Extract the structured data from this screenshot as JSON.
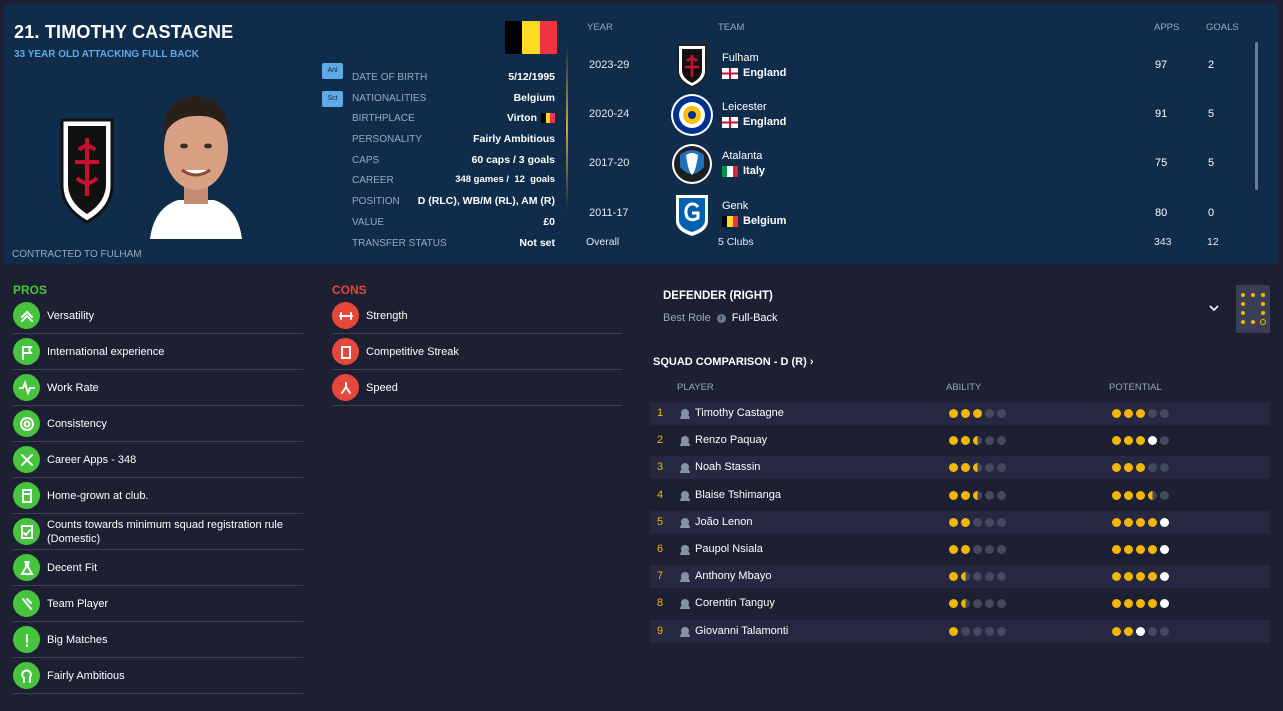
{
  "player": {
    "name": "21. TIMOTHY CASTAGNE",
    "descriptor": "33 YEAR OLD ATTACKING FULL BACK",
    "contract": "CONTRACTED TO FULHAM",
    "tag1": "Anl",
    "tag2": "Sct"
  },
  "info": [
    {
      "label": "DATE OF BIRTH",
      "value": "5/12/1995"
    },
    {
      "label": "NATIONALITIES",
      "value": "Belgium"
    },
    {
      "label": "BIRTHPLACE",
      "value": "Virton"
    },
    {
      "label": "PERSONALITY",
      "value": "Fairly Ambitious"
    },
    {
      "label": "CAPS",
      "value": "60 caps / 3 goals"
    },
    {
      "label": "CAREER",
      "value": "348 games /  12  goals"
    },
    {
      "label": "POSITION",
      "value": "D (RLC), WB/M (RL), AM (R)"
    },
    {
      "label": "VALUE",
      "value": "£0"
    },
    {
      "label": "TRANSFER STATUS",
      "value": "Not set"
    }
  ],
  "career": {
    "headers": {
      "year": "YEAR",
      "team": "TEAM",
      "apps": "APPS",
      "goals": "GOALS"
    },
    "rows": [
      {
        "year": "2023-29",
        "team": "Fulham",
        "country": "England",
        "apps": "97",
        "goals": "2",
        "logo": "fulham-crest-icon"
      },
      {
        "year": "2020-24",
        "team": "Leicester",
        "country": "England",
        "apps": "91",
        "goals": "5",
        "logo": "leicester-crest-icon"
      },
      {
        "year": "2017-20",
        "team": "Atalanta",
        "country": "Italy",
        "apps": "75",
        "goals": "5",
        "logo": "atalanta-crest-icon"
      },
      {
        "year": "2011-17",
        "team": "Genk",
        "country": "Belgium",
        "apps": "80",
        "goals": "0",
        "logo": "genk-crest-icon"
      }
    ],
    "overall": {
      "label": "Overall",
      "clubs": "5 Clubs",
      "apps": "343",
      "goals": "12"
    }
  },
  "pros": {
    "title": "PROS",
    "items": [
      "Versatility",
      "International experience",
      "Work Rate",
      "Consistency",
      "Career Apps - 348",
      "Home-grown at club.",
      "Counts towards minimum squad registration rule (Domestic)",
      "Decent Fit",
      "Team Player",
      "Big Matches",
      "Fairly Ambitious"
    ]
  },
  "cons": {
    "title": "CONS",
    "items": [
      "Strength",
      "Competitive Streak",
      "Speed"
    ]
  },
  "role": {
    "title": "DEFENDER (RIGHT)",
    "best_role_label": "Best Role",
    "best_role": "Full-Back"
  },
  "squad": {
    "title": "SQUAD COMPARISON - D (R)",
    "headers": {
      "player": "PLAYER",
      "ability": "ABILITY",
      "potential": "POTENTIAL"
    },
    "rows": [
      {
        "n": "1",
        "name": "Timothy Castagne",
        "ability": 3,
        "potential": 3,
        "potential_white": 0
      },
      {
        "n": "2",
        "name": "Renzo Paquay",
        "ability": 2.5,
        "potential": 3,
        "potential_white": 1
      },
      {
        "n": "3",
        "name": "Noah Stassin",
        "ability": 2.5,
        "potential": 3,
        "potential_white": 0
      },
      {
        "n": "4",
        "name": "Blaise Tshimanga",
        "ability": 2.5,
        "potential": 3.5,
        "potential_white": 0.5
      },
      {
        "n": "5",
        "name": "João Lenon",
        "ability": 2,
        "potential": 4,
        "potential_white": 1
      },
      {
        "n": "6",
        "name": "Paupol Nsiala",
        "ability": 2,
        "potential": 4,
        "potential_white": 1
      },
      {
        "n": "7",
        "name": "Anthony Mbayo",
        "ability": 1.5,
        "potential": 4,
        "potential_white": 1
      },
      {
        "n": "8",
        "name": "Corentin Tanguy",
        "ability": 1.5,
        "potential": 4,
        "potential_white": 1
      },
      {
        "n": "9",
        "name": "Giovanni Talamonti",
        "ability": 1,
        "potential": 2,
        "potential_white": 1
      }
    ]
  },
  "colors": {
    "accent": "#5fa9e6",
    "pros": "#47c43e",
    "cons": "#e5483a",
    "star": "#f2b705"
  }
}
